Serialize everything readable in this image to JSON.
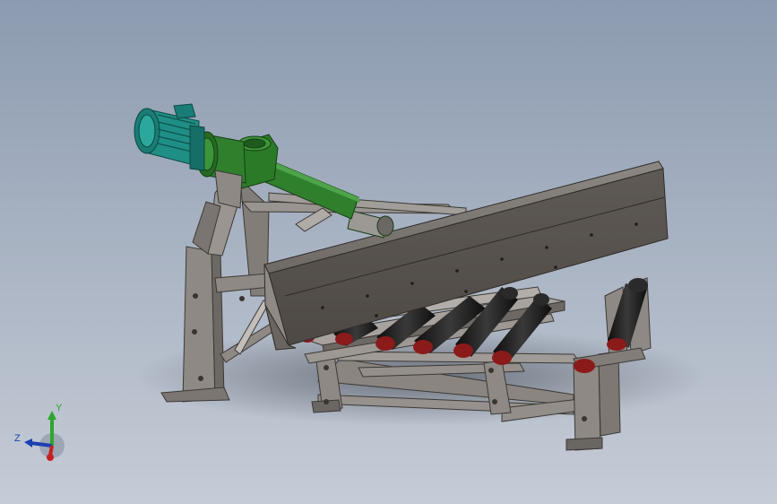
{
  "viewport": {
    "background_top": "#8c9bb0",
    "background_bottom": "#c6ccd6"
  },
  "model": {
    "parts": [
      {
        "name": "motor",
        "icon": "electric-motor",
        "color": "#1f8f86"
      },
      {
        "name": "gear-reducer-housing",
        "icon": "gearbox",
        "color": "#2f7f2c"
      },
      {
        "name": "screw-conveyor-tube",
        "icon": "tube",
        "color": "#2f7f2c"
      },
      {
        "name": "chute-trough",
        "icon": "trough",
        "color": "#5e5955"
      },
      {
        "name": "support-frame",
        "icon": "steel-frame",
        "color": "#8a8580"
      },
      {
        "name": "conveyor-rollers",
        "icon": "roller",
        "color": "#1e1e1e"
      },
      {
        "name": "roller-end-caps",
        "icon": "bearing-cap",
        "color": "#8b1a1a"
      }
    ]
  },
  "triad": {
    "y_label": "Y",
    "z_label": "Z",
    "y_color": "#2fa52f",
    "z_color": "#1c3fb0",
    "x_color": "#c62020"
  }
}
